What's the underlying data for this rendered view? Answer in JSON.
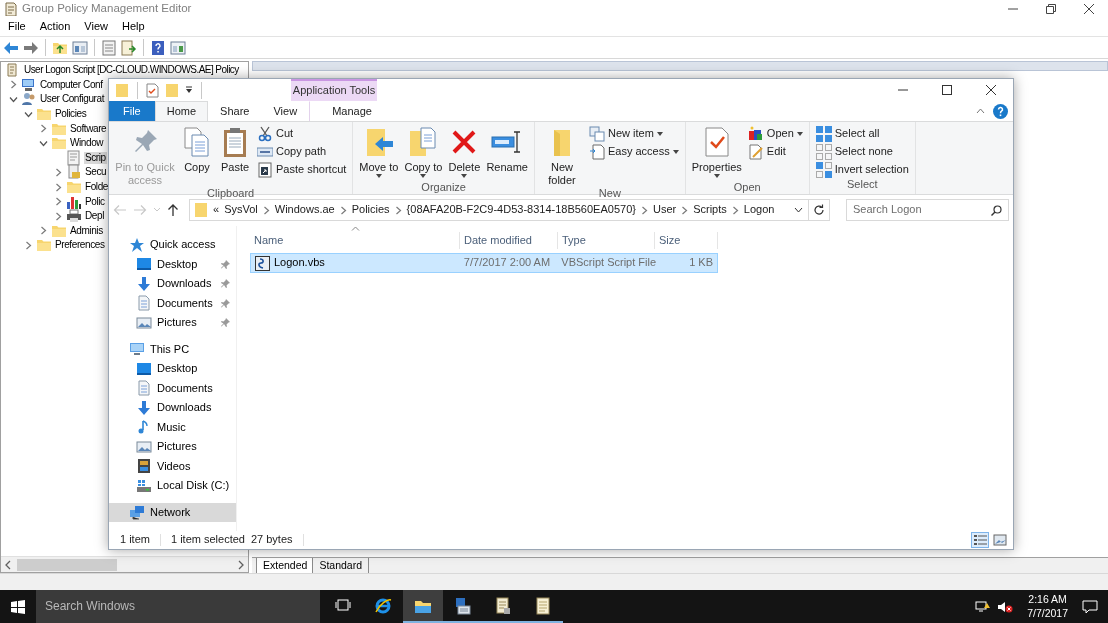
{
  "gpme": {
    "title": "Group Policy Management Editor",
    "menu": [
      "File",
      "Action",
      "View",
      "Help"
    ],
    "tree": [
      {
        "label": "User Logon Script [DC-CLOUD.WINDOWS.AE] Policy",
        "kind": "policy",
        "selected": false,
        "children": [
          {
            "label": "Computer Conf",
            "kind": "computer",
            "expanded": false,
            "selected": false
          },
          {
            "label": "User Configurat",
            "kind": "users",
            "expanded": true,
            "selected": false,
            "children": [
              {
                "label": "Policies",
                "kind": "folder",
                "expanded": true,
                "selected": false,
                "children": [
                  {
                    "label": "Software",
                    "kind": "folder",
                    "expanded": false,
                    "selected": false
                  },
                  {
                    "label": "Window",
                    "kind": "folder",
                    "expanded": true,
                    "selected": false,
                    "children": [
                      {
                        "label": "Scrip",
                        "kind": "script",
                        "selected": true
                      },
                      {
                        "label": "Secu",
                        "kind": "security",
                        "expanded": false,
                        "selected": false
                      },
                      {
                        "label": "Folde",
                        "kind": "folder",
                        "expanded": false,
                        "selected": false
                      },
                      {
                        "label": "Polic",
                        "kind": "chart",
                        "expanded": false,
                        "selected": false
                      },
                      {
                        "label": "Depl",
                        "kind": "printer",
                        "expanded": false,
                        "selected": false
                      }
                    ]
                  },
                  {
                    "label": "Adminis",
                    "kind": "folder",
                    "expanded": false,
                    "selected": false
                  }
                ]
              },
              {
                "label": "Preferences",
                "kind": "folder",
                "expanded": false,
                "selected": false
              }
            ]
          }
        ]
      }
    ],
    "view_tabs": [
      {
        "label": "Extended",
        "selected": true
      },
      {
        "label": "Standard",
        "selected": false
      }
    ]
  },
  "explorer": {
    "contextual_tab": "Application Tools",
    "tabs": [
      {
        "label": "File",
        "kind": "file",
        "selected": false
      },
      {
        "label": "Home",
        "kind": "tab",
        "selected": true
      },
      {
        "label": "Share",
        "kind": "tab",
        "selected": false
      },
      {
        "label": "View",
        "kind": "tab",
        "selected": false
      },
      {
        "label": "Manage",
        "kind": "contextual",
        "selected": false
      }
    ],
    "ribbon": [
      {
        "name": "Clipboard",
        "commands": [
          {
            "label": "Pin to Quick access",
            "kind": "large",
            "disabled": true,
            "dropdown": false
          },
          {
            "label": "Copy",
            "kind": "large",
            "disabled": false,
            "dropdown": false
          },
          {
            "label": "Paste",
            "kind": "large",
            "disabled": false,
            "dropdown": false
          },
          {
            "label": "Cut",
            "kind": "small",
            "disabled": false,
            "dropdown": false
          },
          {
            "label": "Copy path",
            "kind": "small",
            "disabled": false,
            "dropdown": false
          },
          {
            "label": "Paste shortcut",
            "kind": "small",
            "disabled": false,
            "dropdown": false
          }
        ]
      },
      {
        "name": "Organize",
        "commands": [
          {
            "label": "Move to",
            "kind": "large",
            "disabled": false,
            "dropdown": true
          },
          {
            "label": "Copy to",
            "kind": "large",
            "disabled": false,
            "dropdown": true
          },
          {
            "label": "Delete",
            "kind": "large",
            "disabled": false,
            "dropdown": true
          },
          {
            "label": "Rename",
            "kind": "large",
            "disabled": false,
            "dropdown": false
          }
        ]
      },
      {
        "name": "New",
        "commands": [
          {
            "label": "New folder",
            "kind": "large",
            "disabled": false,
            "dropdown": false
          },
          {
            "label": "New item",
            "kind": "small",
            "disabled": false,
            "dropdown": true
          },
          {
            "label": "Easy access",
            "kind": "small",
            "disabled": false,
            "dropdown": true
          }
        ]
      },
      {
        "name": "Open",
        "commands": [
          {
            "label": "Properties",
            "kind": "large",
            "disabled": false,
            "dropdown": true
          },
          {
            "label": "Open",
            "kind": "small",
            "disabled": false,
            "dropdown": true
          },
          {
            "label": "Edit",
            "kind": "small",
            "disabled": false,
            "dropdown": false
          }
        ]
      },
      {
        "name": "Select",
        "commands": [
          {
            "label": "Select all",
            "kind": "small",
            "disabled": false,
            "dropdown": false
          },
          {
            "label": "Select none",
            "kind": "small",
            "disabled": false,
            "dropdown": false
          },
          {
            "label": "Invert selection",
            "kind": "small",
            "disabled": false,
            "dropdown": false
          }
        ]
      }
    ],
    "address": {
      "overflow": "«",
      "crumbs": [
        "SysVol",
        "Windows.ae",
        "Policies",
        "{08AFA20B-F2C9-4D53-8314-18B560EA0570}",
        "User",
        "Scripts",
        "Logon"
      ]
    },
    "back_disabled": true,
    "forward_disabled": true,
    "search": {
      "placeholder": "Search Logon"
    },
    "nav": [
      {
        "label": "Quick access",
        "selected": false,
        "children": [
          {
            "label": "Desktop",
            "pinned": true,
            "selected": false
          },
          {
            "label": "Downloads",
            "pinned": true,
            "selected": false
          },
          {
            "label": "Documents",
            "pinned": true,
            "selected": false
          },
          {
            "label": "Pictures",
            "pinned": true,
            "selected": false
          }
        ]
      },
      {
        "label": "This PC",
        "selected": false,
        "children": [
          {
            "label": "Desktop",
            "pinned": false,
            "selected": false
          },
          {
            "label": "Documents",
            "pinned": false,
            "selected": false
          },
          {
            "label": "Downloads",
            "pinned": false,
            "selected": false
          },
          {
            "label": "Music",
            "pinned": false,
            "selected": false
          },
          {
            "label": "Pictures",
            "pinned": false,
            "selected": false
          },
          {
            "label": "Videos",
            "pinned": false,
            "selected": false
          },
          {
            "label": "Local Disk (C:)",
            "pinned": false,
            "selected": false
          }
        ]
      },
      {
        "label": "Network",
        "selected": true
      }
    ],
    "columns": [
      {
        "label": "Name",
        "sorted": true
      },
      {
        "label": "Date modified",
        "sorted": false
      },
      {
        "label": "Type",
        "sorted": false
      },
      {
        "label": "Size",
        "sorted": false
      }
    ],
    "rows": [
      {
        "cells": [
          "Logon.vbs",
          "7/7/2017 2:00 AM",
          "VBScript Script File",
          "1 KB"
        ],
        "selected": true
      }
    ],
    "status": {
      "count": "1 item",
      "selection": "1 item selected",
      "size": "27 bytes"
    },
    "views": [
      {
        "kind": "details",
        "selected": true
      },
      {
        "kind": "large_icons",
        "selected": false
      }
    ]
  },
  "taskbar": {
    "search": {
      "placeholder": "Search Windows"
    },
    "apps": [
      {
        "kind": "task_view",
        "running": false,
        "active": false
      },
      {
        "kind": "browser",
        "running": false,
        "active": false
      },
      {
        "kind": "explorer",
        "running": true,
        "active": true
      },
      {
        "kind": "server",
        "running": true,
        "active": false
      },
      {
        "kind": "script",
        "running": true,
        "active": false
      },
      {
        "kind": "notepad",
        "running": true,
        "active": false
      }
    ],
    "volume_muted": true,
    "time": "2:16 AM",
    "date": "7/7/2017"
  }
}
